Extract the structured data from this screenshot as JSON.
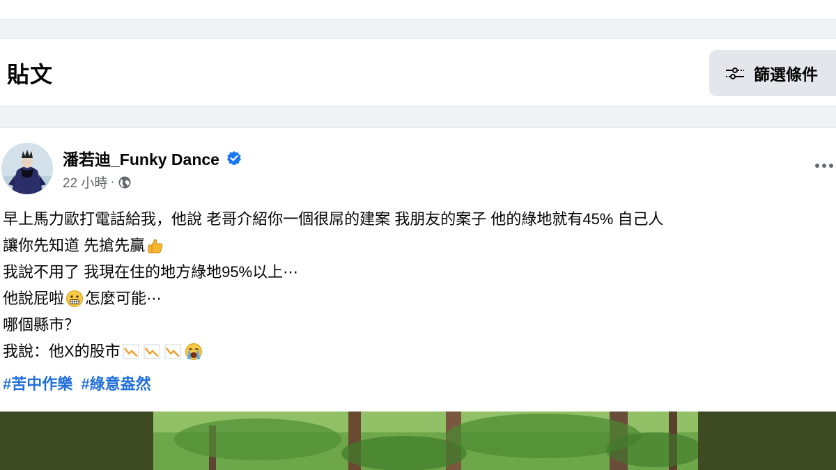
{
  "header": {
    "title": "貼文",
    "filter_label": "篩選條件"
  },
  "post": {
    "author": "潘若迪_Funky Dance",
    "time": "22 小時",
    "separator": "·",
    "lines": [
      "早上馬力歐打電話給我，他說 老哥介紹你一個很屌的建案 我朋友的案子 他的綠地就有45% 自己人",
      "讓你先知道 先搶先贏",
      "我說不用了 我現在住的地方綠地95%以上⋯",
      "他說屁啦",
      "怎麼可能⋯",
      "哪個縣市？",
      "我說：他X的股市"
    ],
    "hashtags": [
      "#苦中作樂",
      "#綠意盎然"
    ]
  },
  "colors": {
    "link": "#216fdb",
    "verified": "#1877f2",
    "secondary_text": "#65676b"
  },
  "icons": {
    "filter": "filter-sliders-icon",
    "verified": "verified-badge-icon",
    "globe": "globe-icon",
    "more": "more-options-icon",
    "thumbs_up": "thumbs-up-emoji",
    "grimace": "grimacing-face-emoji",
    "chart_down": "chart-decreasing-emoji",
    "crying": "loudly-crying-face-emoji"
  }
}
